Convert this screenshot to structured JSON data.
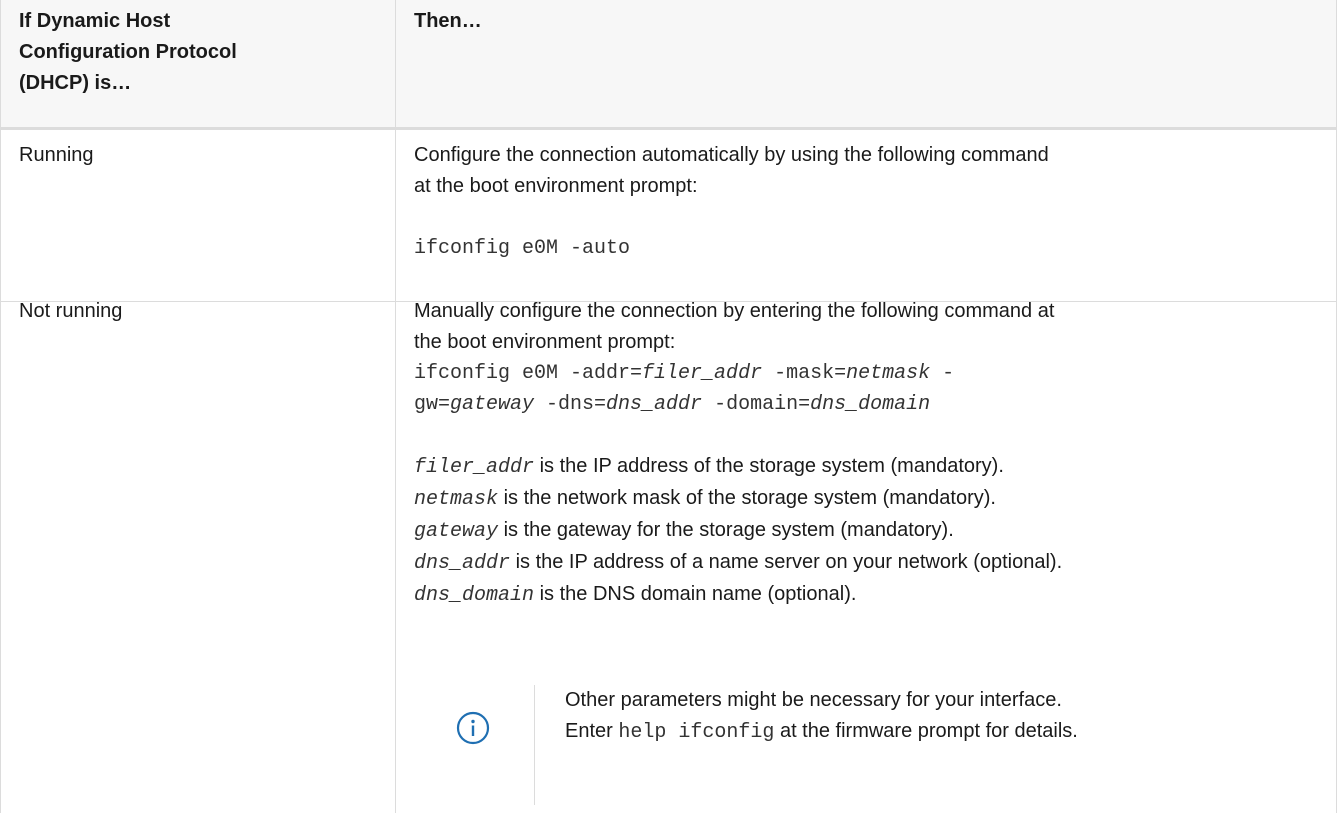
{
  "table": {
    "header": {
      "col1_line1": "If Dynamic Host",
      "col1_line2": "Configuration Protocol",
      "col1_line3": "(DHCP) is…",
      "col2": "Then…"
    },
    "row1": {
      "condition": "Running",
      "para_line1": "Configure the connection automatically by using the following command",
      "para_line2": "at the boot environment prompt:",
      "command": "ifconfig e0M -auto"
    },
    "row2": {
      "condition": "Not running",
      "para_line1": "Manually configure the connection by entering the following command at",
      "para_line2": "the boot environment prompt:",
      "cmd_line1_a": "ifconfig e0M -addr=",
      "cmd_line1_b": "filer_addr",
      "cmd_line1_c": " -mask=",
      "cmd_line1_d": "netmask",
      "cmd_line1_e": " -",
      "cmd_line2_a": "gw=",
      "cmd_line2_b": "gateway",
      "cmd_line2_c": " -dns=",
      "cmd_line2_d": "dns_addr",
      "cmd_line2_e": " -domain=",
      "cmd_line2_f": "dns_domain",
      "definitions": [
        {
          "term": "filer_addr",
          "desc": " is the IP address of the storage system (mandatory)."
        },
        {
          "term": "netmask",
          "desc": " is the network mask of the storage system (mandatory)."
        },
        {
          "term": "gateway",
          "desc": " is the gateway for the storage system (mandatory)."
        },
        {
          "term": "dns_addr",
          "desc": " is the IP address of a name server on your network (optional)."
        },
        {
          "term": "dns_domain",
          "desc": " is the DNS domain name (optional)."
        }
      ],
      "note": {
        "icon": "info-icon",
        "line1": "Other parameters might be necessary for your interface.",
        "line2_a": "Enter ",
        "line2_code": "help ifconfig",
        "line2_b": " at the firmware prompt for details."
      }
    },
    "colors": {
      "border": "#dcdcdc",
      "header_bg": "#f7f7f7",
      "icon": "#1f6fb2"
    }
  }
}
